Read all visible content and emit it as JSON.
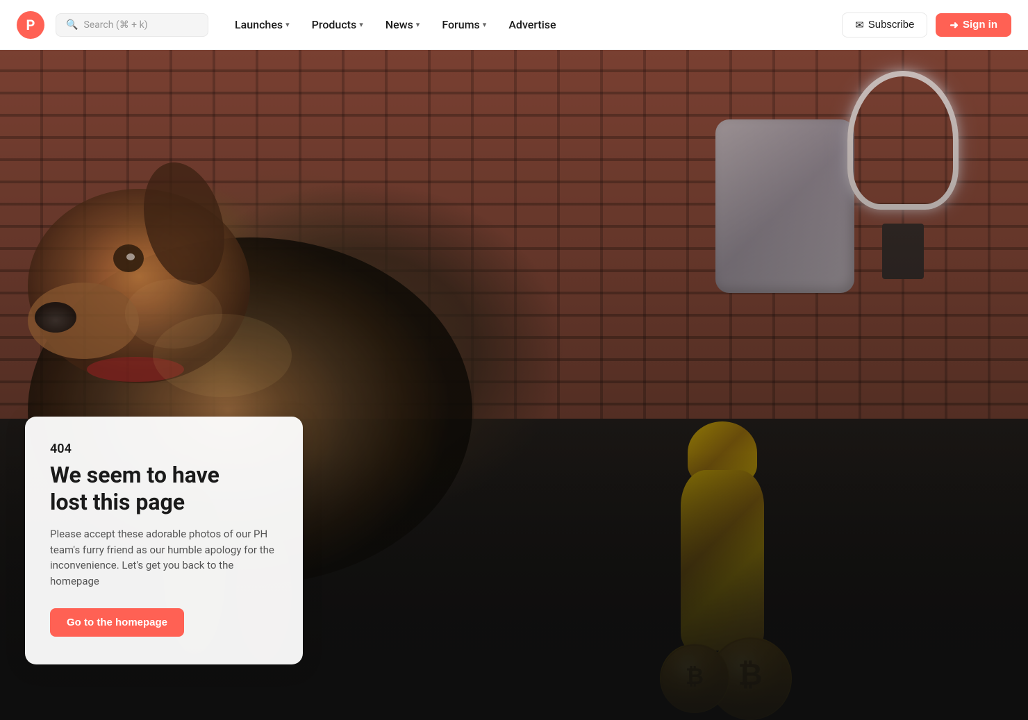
{
  "brand": {
    "logo_letter": "P",
    "logo_color": "#ff6154"
  },
  "navbar": {
    "search_placeholder": "Search (⌘ + k)",
    "items": [
      {
        "label": "Launches",
        "has_dropdown": true
      },
      {
        "label": "Products",
        "has_dropdown": true
      },
      {
        "label": "News",
        "has_dropdown": true
      },
      {
        "label": "Forums",
        "has_dropdown": true
      },
      {
        "label": "Advertise",
        "has_dropdown": false
      }
    ],
    "subscribe_label": "Subscribe",
    "signin_label": "Sign in"
  },
  "error_page": {
    "error_code": "404",
    "title_line1": "We seem to have",
    "title_line2": "lost this page",
    "description": "Please accept these adorable photos of our PH team's furry friend as our humble apology for the inconvenience. Let's get you back to the homepage",
    "cta_label": "Go to the homepage"
  }
}
